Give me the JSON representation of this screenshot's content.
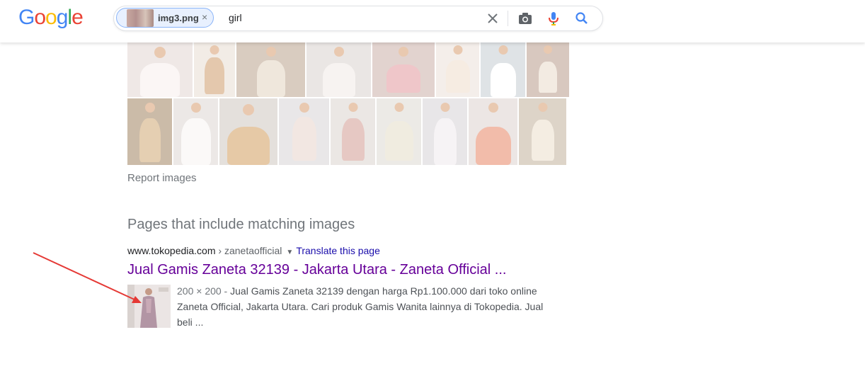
{
  "header": {
    "logo_letters": [
      {
        "ch": "G",
        "color": "#4285F4"
      },
      {
        "ch": "o",
        "color": "#EA4335"
      },
      {
        "ch": "o",
        "color": "#FBBC05"
      },
      {
        "ch": "g",
        "color": "#4285F4"
      },
      {
        "ch": "l",
        "color": "#34A853"
      },
      {
        "ch": "e",
        "color": "#EA4335"
      }
    ],
    "search": {
      "image_chip_label": "img3.png",
      "chip_close": "×",
      "query": "girl"
    }
  },
  "images": {
    "report_label": "Report images"
  },
  "pages_section": {
    "title": "Pages that include matching images",
    "result": {
      "domain": "www.tokopedia.com",
      "path": " › zanetaofficial",
      "translate_label": "Translate this page",
      "title": "Jual Gamis Zaneta 32139 - Jakarta Utara - Zaneta Official ...",
      "meta": "200 × 200 - ",
      "snippet": "Jual Gamis Zaneta 32139 dengan harga Rp1.100.000 dari toko online Zaneta Official, Jakarta Utara. Cari produk Gamis Wanita lainnya di Tokopedia. Jual beli ..."
    }
  },
  "colors": {
    "link_visited": "#660099",
    "link": "#1a0dab",
    "annotation_arrow": "#e53935"
  },
  "icons": [
    "close-icon",
    "camera-icon",
    "mic-icon",
    "search-icon"
  ]
}
